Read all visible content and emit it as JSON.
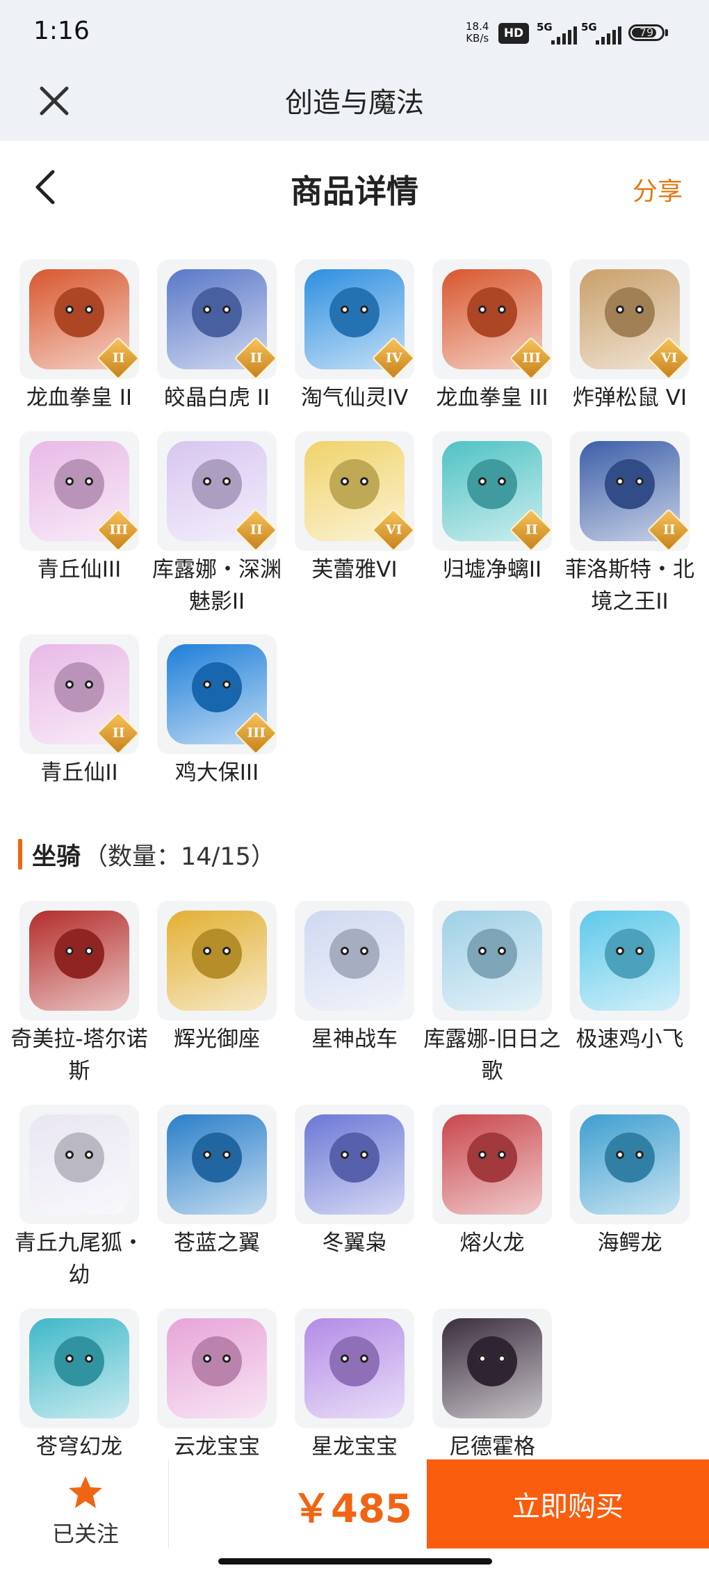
{
  "status_bar": {
    "time": "1:16",
    "net_speed_value": "18.4",
    "net_speed_unit": "KB/s",
    "hd_badge": "HD",
    "signal_1": "5G",
    "signal_2": "5G",
    "battery_level": "79"
  },
  "app_bar": {
    "title": "创造与魔法",
    "close_icon": "close-icon"
  },
  "header": {
    "title": "商品详情",
    "share_label": "分享",
    "back_icon": "chevron-left-icon"
  },
  "pets": [
    {
      "name": "龙血拳皇 II",
      "rank": "II",
      "color": "#d8572e"
    },
    {
      "name": "皎晶白虎 II",
      "rank": "II",
      "color": "#5a78c8"
    },
    {
      "name": "淘气仙灵IV",
      "rank": "IV",
      "color": "#2e8fe0"
    },
    {
      "name": "龙血拳皇 III",
      "rank": "III",
      "color": "#d8572e"
    },
    {
      "name": "炸弹松鼠 VI",
      "rank": "VI",
      "color": "#c9a06a"
    },
    {
      "name": "青丘仙III",
      "rank": "III",
      "color": "#e8b9e6"
    },
    {
      "name": "库露娜・深渊魅影II",
      "rank": "II",
      "color": "#d7c6f0"
    },
    {
      "name": "芙蕾雅VI",
      "rank": "VI",
      "color": "#f0d36a"
    },
    {
      "name": "归墟净螭II",
      "rank": "II",
      "color": "#4fc2c4"
    },
    {
      "name": "菲洛斯特・北境之王II",
      "rank": "II",
      "color": "#3d5fa8"
    },
    {
      "name": "青丘仙II",
      "rank": "II",
      "color": "#e8b9e6"
    },
    {
      "name": "鸡大保III",
      "rank": "III",
      "color": "#1e7fd8"
    }
  ],
  "mounts_section": {
    "title": "坐骑",
    "count": "（数量：14/15）"
  },
  "mounts": [
    {
      "name": "奇美拉-塔尔诺斯",
      "color": "#b32d2a"
    },
    {
      "name": "辉光御座",
      "color": "#e2b033"
    },
    {
      "name": "星神战车",
      "color": "#cfd8f0"
    },
    {
      "name": "库露娜-旧日之歌",
      "color": "#9fd0e6"
    },
    {
      "name": "极速鸡小飞",
      "color": "#5fc9ea"
    },
    {
      "name": "青丘九尾狐・幼",
      "color": "#e9e6f2"
    },
    {
      "name": "苍蓝之翼",
      "color": "#2a7fc9"
    },
    {
      "name": "冬翼枭",
      "color": "#6b78d6"
    },
    {
      "name": "熔火龙",
      "color": "#c9474c"
    },
    {
      "name": "海鳄龙",
      "color": "#3f9fd0"
    },
    {
      "name": "苍穹幻龙",
      "color": "#3fb8c8"
    },
    {
      "name": "云龙宝宝",
      "color": "#e7a4d8"
    },
    {
      "name": "星龙宝宝",
      "color": "#b38be6"
    },
    {
      "name": "尼德霍格",
      "color": "#3b2e3e"
    }
  ],
  "bottom_bar": {
    "follow_label": "已关注",
    "follow_icon": "star-icon",
    "price": "￥485",
    "buy_label": "立即购买"
  },
  "colors": {
    "accent": "#f06514",
    "buy_button": "#fb5d0e",
    "share": "#e07a13"
  }
}
